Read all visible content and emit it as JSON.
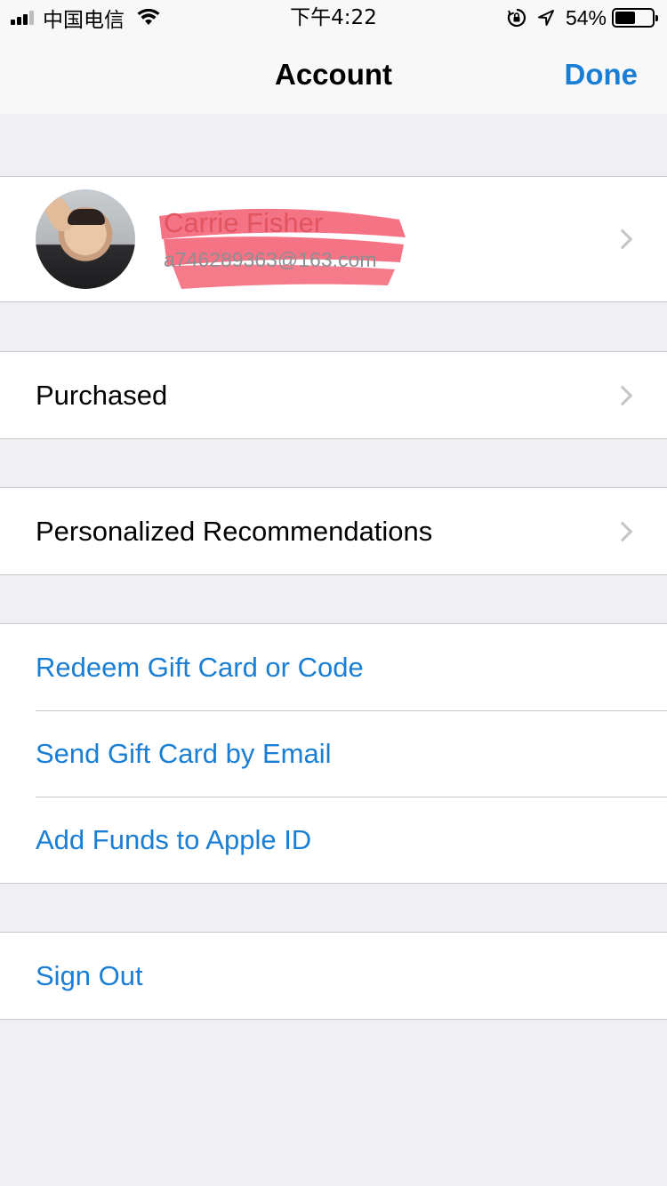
{
  "status_bar": {
    "carrier": "中国电信",
    "time": "下午4:22",
    "battery_percent": "54%",
    "battery_level": 0.54,
    "icons": [
      "signal-icon",
      "wifi-icon",
      "orientation-lock-icon",
      "location-icon",
      "battery-icon"
    ]
  },
  "nav": {
    "title": "Account",
    "done_label": "Done"
  },
  "profile": {
    "name": "Carrie Fisher",
    "email": "a746289363@163.com"
  },
  "menu": {
    "purchased": "Purchased",
    "recommendations": "Personalized Recommendations",
    "redeem": "Redeem Gift Card or Code",
    "send_gift": "Send Gift Card by Email",
    "add_funds": "Add Funds to Apple ID",
    "sign_out": "Sign Out"
  },
  "colors": {
    "accent": "#1a7fd4",
    "background": "#efeff4",
    "separator": "#c8c7cc",
    "redaction": "#f25a6e"
  }
}
